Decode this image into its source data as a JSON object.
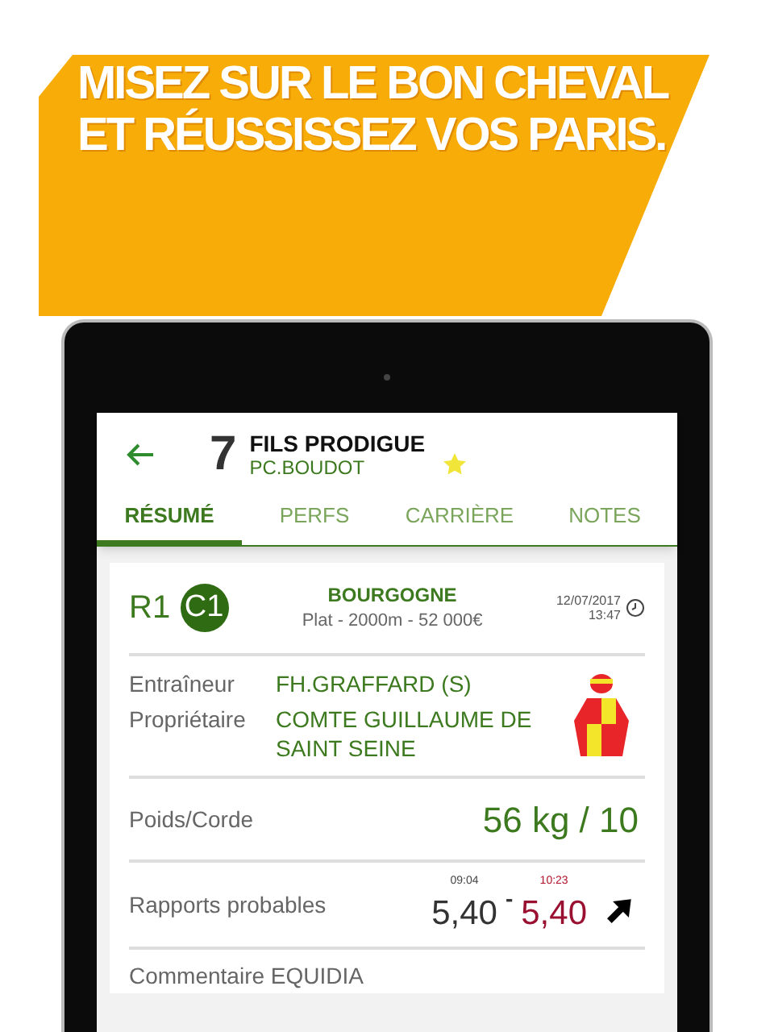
{
  "headline": [
    "MISEZ SUR LE BON CHEVAL",
    "ET RÉUSSISSEZ VOS PARIS."
  ],
  "horse": {
    "number": "7",
    "name": "FILS PRODIGUE",
    "jockey": "PC.BOUDOT",
    "favorite": true
  },
  "tabs": [
    {
      "label": "RÉSUMÉ",
      "selected": true
    },
    {
      "label": "PERFS",
      "selected": false
    },
    {
      "label": "CARRIÈRE",
      "selected": false
    },
    {
      "label": "NOTES",
      "selected": false
    }
  ],
  "race": {
    "meeting": "R1",
    "course": "C1",
    "name": "BOURGOGNE",
    "details": "Plat - 2000m - 52 000€",
    "date": "12/07/2017",
    "time": "13:47"
  },
  "people": [
    {
      "label": "Entraîneur",
      "value": "FH.GRAFFARD (S)"
    },
    {
      "label": "Propriétaire",
      "value": "COMTE GUILLAUME DE SAINT SEINE"
    }
  ],
  "weight": {
    "label": "Poids/Corde",
    "value": "56 kg / 10"
  },
  "odds": {
    "label": "Rapports probables",
    "first_time": "09:04",
    "first_value": "5,40",
    "separator": "-",
    "last_time": "10:23",
    "last_value": "5,40",
    "rising": true
  },
  "commentary": {
    "label": "Commentaire EQUIDIA"
  }
}
